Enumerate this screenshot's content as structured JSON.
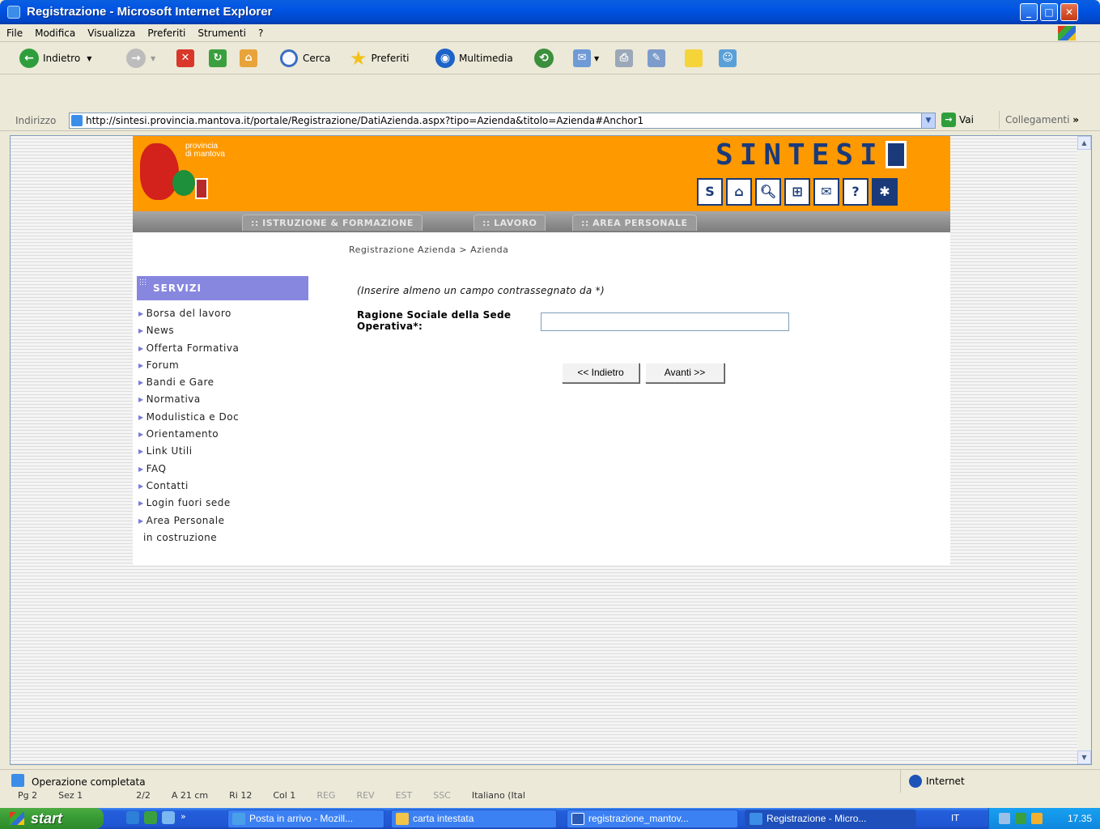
{
  "window": {
    "title": "Registrazione - Microsoft Internet Explorer",
    "min": "_",
    "max": "□",
    "close": "✕"
  },
  "menu": [
    "File",
    "Modifica",
    "Visualizza",
    "Preferiti",
    "Strumenti",
    "?"
  ],
  "toolbar": {
    "back": "Indietro",
    "search": "Cerca",
    "favorites": "Preferiti",
    "media": "Multimedia"
  },
  "address": {
    "label": "Indirizzo",
    "url": "http://sintesi.provincia.mantova.it/portale/Registrazione/DatiAzienda.aspx?tipo=Azienda&titolo=Azienda#Anchor1",
    "go": "Vai",
    "links": "Collegamenti"
  },
  "site": {
    "logo_text_1": "provincia",
    "logo_text_2": "di mantova",
    "brand": "SINTESI",
    "nav": [
      ":: ISTRUZIONE & FORMAZIONE",
      ":: LAVORO",
      ":: AREA PERSONALE"
    ],
    "breadcrumb": "Registrazione Azienda > Azienda",
    "sidebar_title": "SERVIZI",
    "sidebar_items": [
      "Borsa del lavoro",
      "News",
      "Offerta Formativa",
      "Forum",
      "Bandi e Gare",
      "Normativa",
      "Modulistica e Doc",
      "Orientamento",
      "Link Utili",
      "FAQ",
      "Contatti",
      "Login fuori sede",
      "Area Personale"
    ],
    "sidebar_note": "in costruzione",
    "form_hint": "(Inserire almeno un campo contrassegnato da *)",
    "field_label": "Ragione Sociale della Sede Operativa*:",
    "field_value": "",
    "btn_back": "<< Indietro",
    "btn_next": "Avanti >>"
  },
  "status": {
    "text": "Operazione completata",
    "zone": "Internet"
  },
  "word_strip": [
    "Pg 2",
    "Sez 1",
    "2/2",
    "A 21 cm",
    "Ri 12",
    "Col 1",
    "REG",
    "REV",
    "EST",
    "SSC",
    "Italiano (Ital"
  ],
  "taskbar": {
    "start": "start",
    "tasks": [
      "Posta in arrivo - Mozill...",
      "carta intestata",
      "registrazione_mantov...",
      "Registrazione - Micro..."
    ],
    "lang": "IT",
    "clock": "17.35"
  },
  "colors": {
    "header_orange": "#ff9900",
    "servizi_purple": "#8787e0",
    "brand_blue": "#1a3a7a"
  }
}
